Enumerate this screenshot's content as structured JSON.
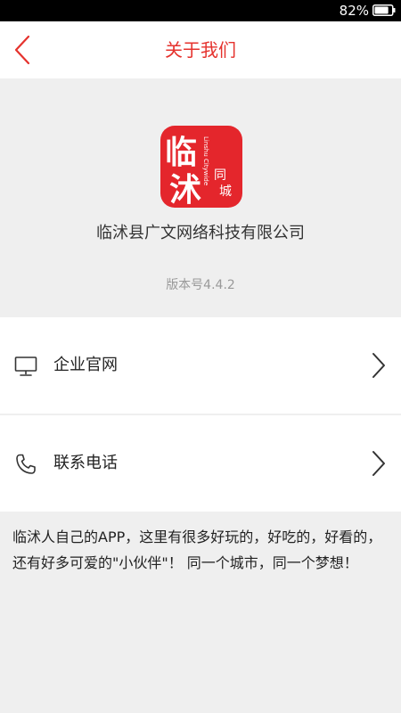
{
  "status_bar": {
    "battery_percent": "82%",
    "battery_level": 0.82
  },
  "nav": {
    "title": "关于我们",
    "back_icon": "chevron-left-icon",
    "accent_color": "#e5322d"
  },
  "app": {
    "logo_main_text": "临沭",
    "logo_side_text": "同城",
    "logo_latin_text": "Linshu Citywide",
    "logo_color": "#e4262c",
    "company_name": "临沭县广文网络科技有限公司",
    "version": "版本号4.4.2"
  },
  "menu": {
    "items": [
      {
        "label": "企业官网",
        "icon": "monitor-icon"
      },
      {
        "label": "联系电话",
        "icon": "phone-icon"
      }
    ]
  },
  "description": "临沭人自己的APP，这里有很多好玩的，好吃的，好看的，还有好多可爱的\"小伙伴\"！ 同一个城市，同一个梦想！"
}
